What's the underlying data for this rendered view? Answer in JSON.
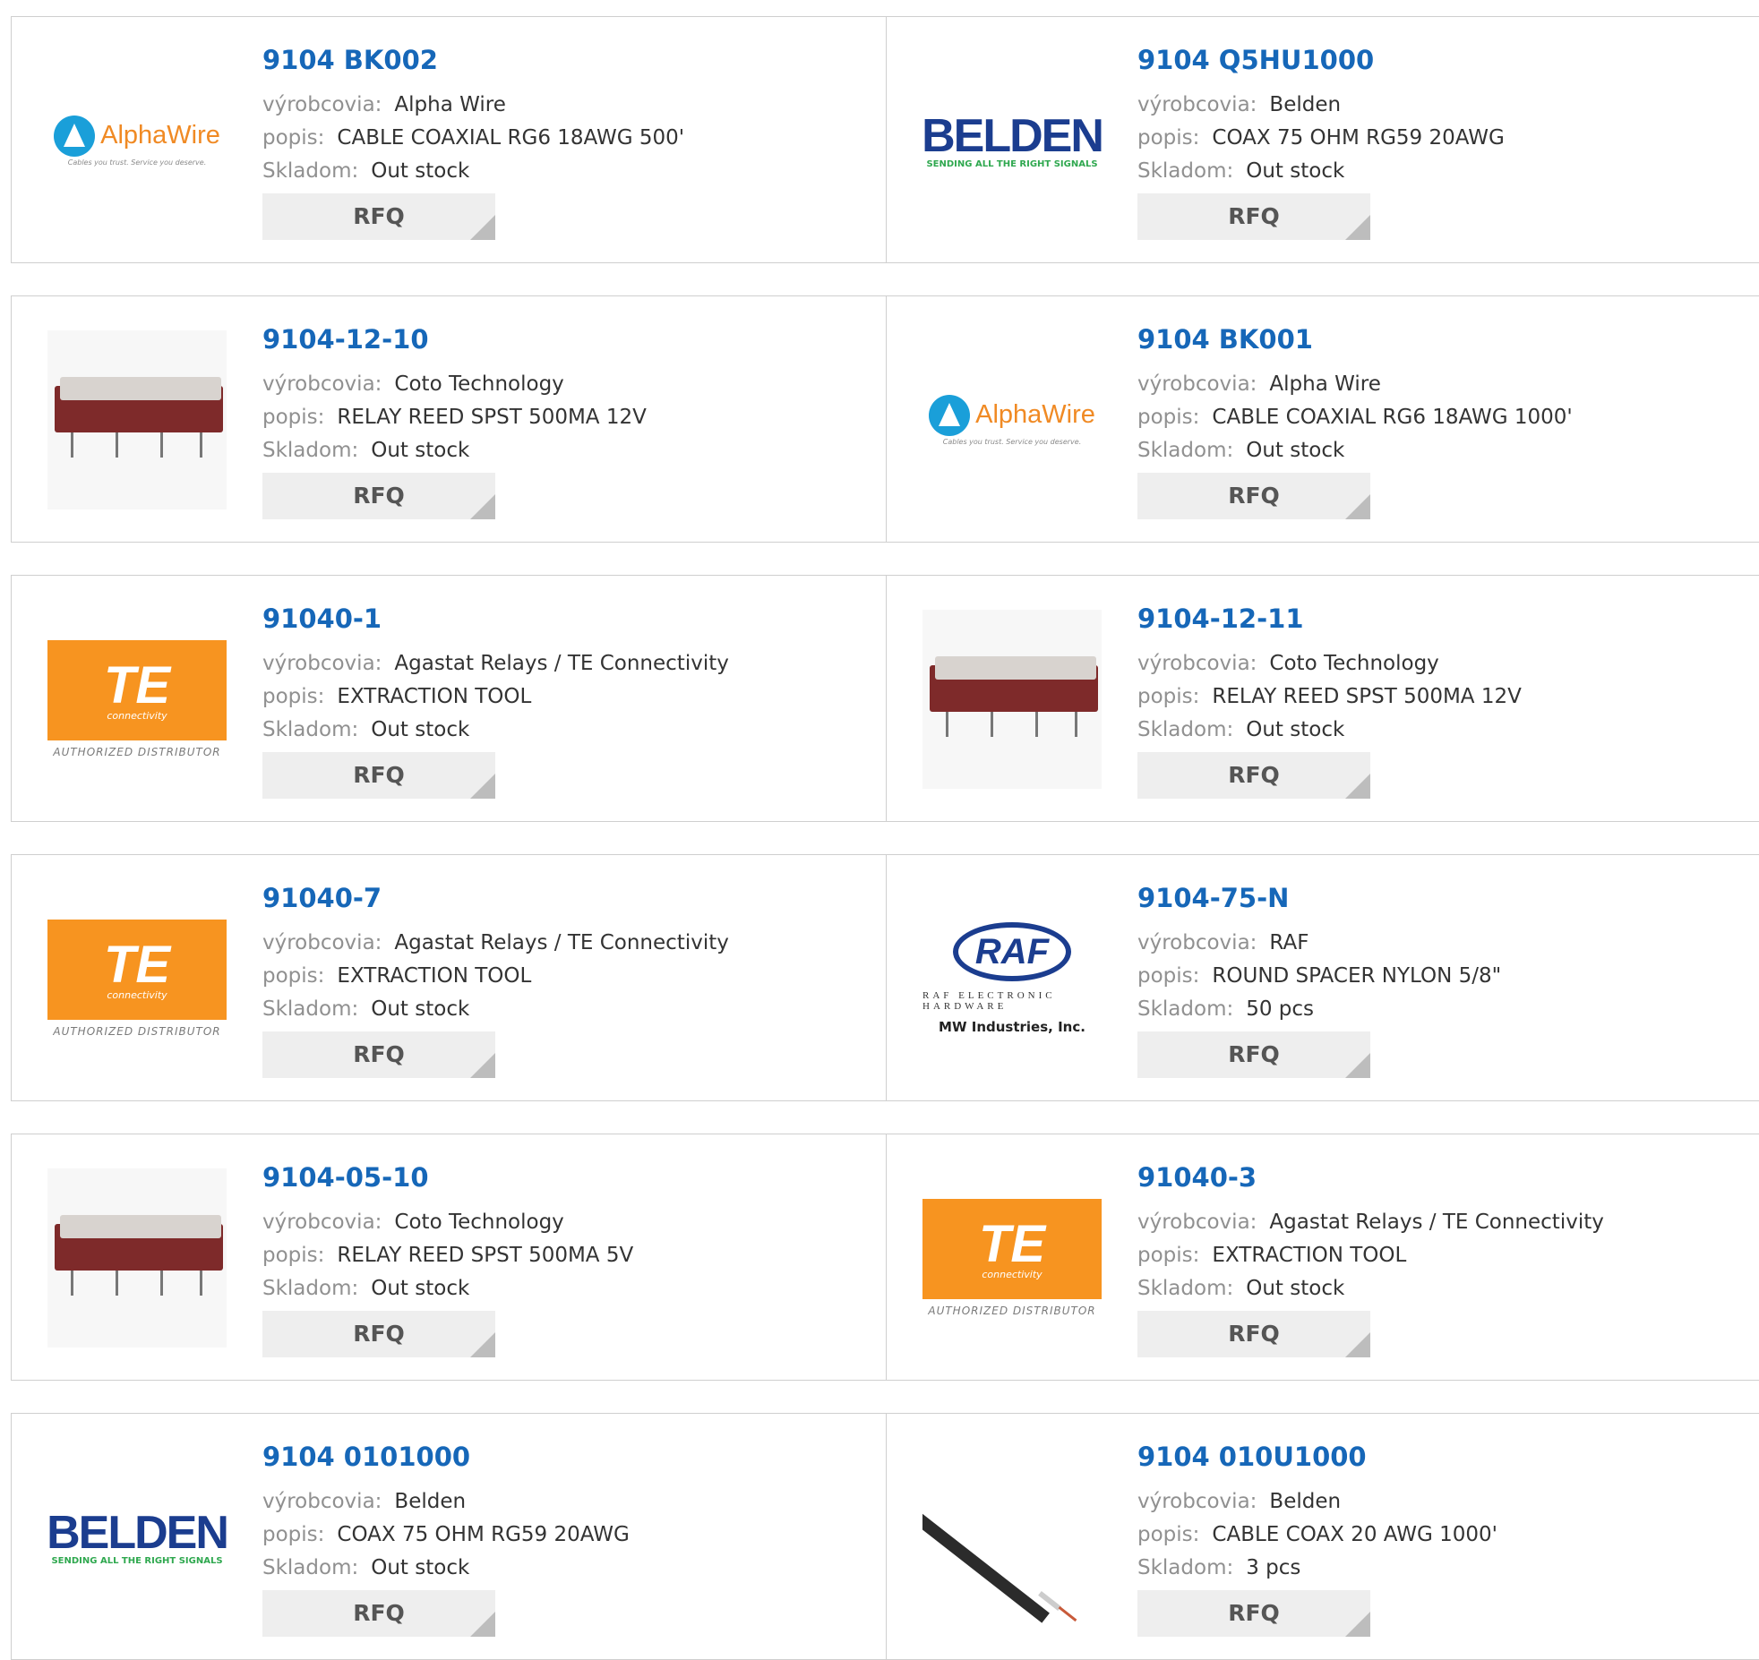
{
  "labels": {
    "manufacturer": "výrobcovia:",
    "description": "popis:",
    "stock": "Skladom:",
    "rfq": "RFQ"
  },
  "colors": {
    "part_number": "#1667b8",
    "button_bg": "#eeeeee",
    "alpha_blue": "#1a9fd9",
    "te_orange": "#f79420",
    "belden_blue": "#1b3d8f"
  },
  "products": [
    {
      "part_number": "9104 BK002",
      "manufacturer": "Alpha Wire",
      "description": "CABLE COAXIAL RG6 18AWG 500'",
      "stock": "Out stock",
      "logo": "alphawire-logo"
    },
    {
      "part_number": "9104 Q5HU1000",
      "manufacturer": "Belden",
      "description": "COAX 75 OHM RG59 20AWG",
      "stock": "Out stock",
      "logo": "belden-logo"
    },
    {
      "part_number": "9104-12-10",
      "manufacturer": "Coto Technology",
      "description": "RELAY REED SPST 500MA 12V",
      "stock": "Out stock",
      "logo": "relay-image"
    },
    {
      "part_number": "9104 BK001",
      "manufacturer": "Alpha Wire",
      "description": "CABLE COAXIAL RG6 18AWG 1000'",
      "stock": "Out stock",
      "logo": "alphawire-logo"
    },
    {
      "part_number": "91040-1",
      "manufacturer": "Agastat Relays / TE Connectivity",
      "description": "EXTRACTION TOOL",
      "stock": "Out stock",
      "logo": "te-logo"
    },
    {
      "part_number": "9104-12-11",
      "manufacturer": "Coto Technology",
      "description": "RELAY REED SPST 500MA 12V",
      "stock": "Out stock",
      "logo": "relay-image"
    },
    {
      "part_number": "91040-7",
      "manufacturer": "Agastat Relays / TE Connectivity",
      "description": "EXTRACTION TOOL",
      "stock": "Out stock",
      "logo": "te-logo"
    },
    {
      "part_number": "9104-75-N",
      "manufacturer": "RAF",
      "description": "ROUND SPACER NYLON 5/8\"",
      "stock": "50 pcs",
      "logo": "raf-logo"
    },
    {
      "part_number": "9104-05-10",
      "manufacturer": "Coto Technology",
      "description": "RELAY REED SPST 500MA 5V",
      "stock": "Out stock",
      "logo": "relay-image"
    },
    {
      "part_number": "91040-3",
      "manufacturer": "Agastat Relays / TE Connectivity",
      "description": "EXTRACTION TOOL",
      "stock": "Out stock",
      "logo": "te-logo"
    },
    {
      "part_number": "9104 0101000",
      "manufacturer": "Belden",
      "description": "COAX 75 OHM RG59 20AWG",
      "stock": "Out stock",
      "logo": "belden-logo"
    },
    {
      "part_number": "9104 010U1000",
      "manufacturer": "Belden",
      "description": "CABLE COAX 20 AWG 1000'",
      "stock": "3 pcs",
      "logo": "cable-image"
    }
  ],
  "logos": {
    "alphawire": {
      "word": "AlphaWire",
      "tagline": "Cables you trust. Service you deserve."
    },
    "belden": {
      "word": "BELDEN",
      "tagline": "SENDING ALL THE RIGHT SIGNALS"
    },
    "te": {
      "mark": "TE",
      "sub": "connectivity",
      "distributor": "AUTHORIZED DISTRIBUTOR"
    },
    "raf": {
      "mark": "RAF",
      "line1": "RAF ELECTRONIC HARDWARE",
      "line2": "MW Industries, Inc."
    }
  }
}
